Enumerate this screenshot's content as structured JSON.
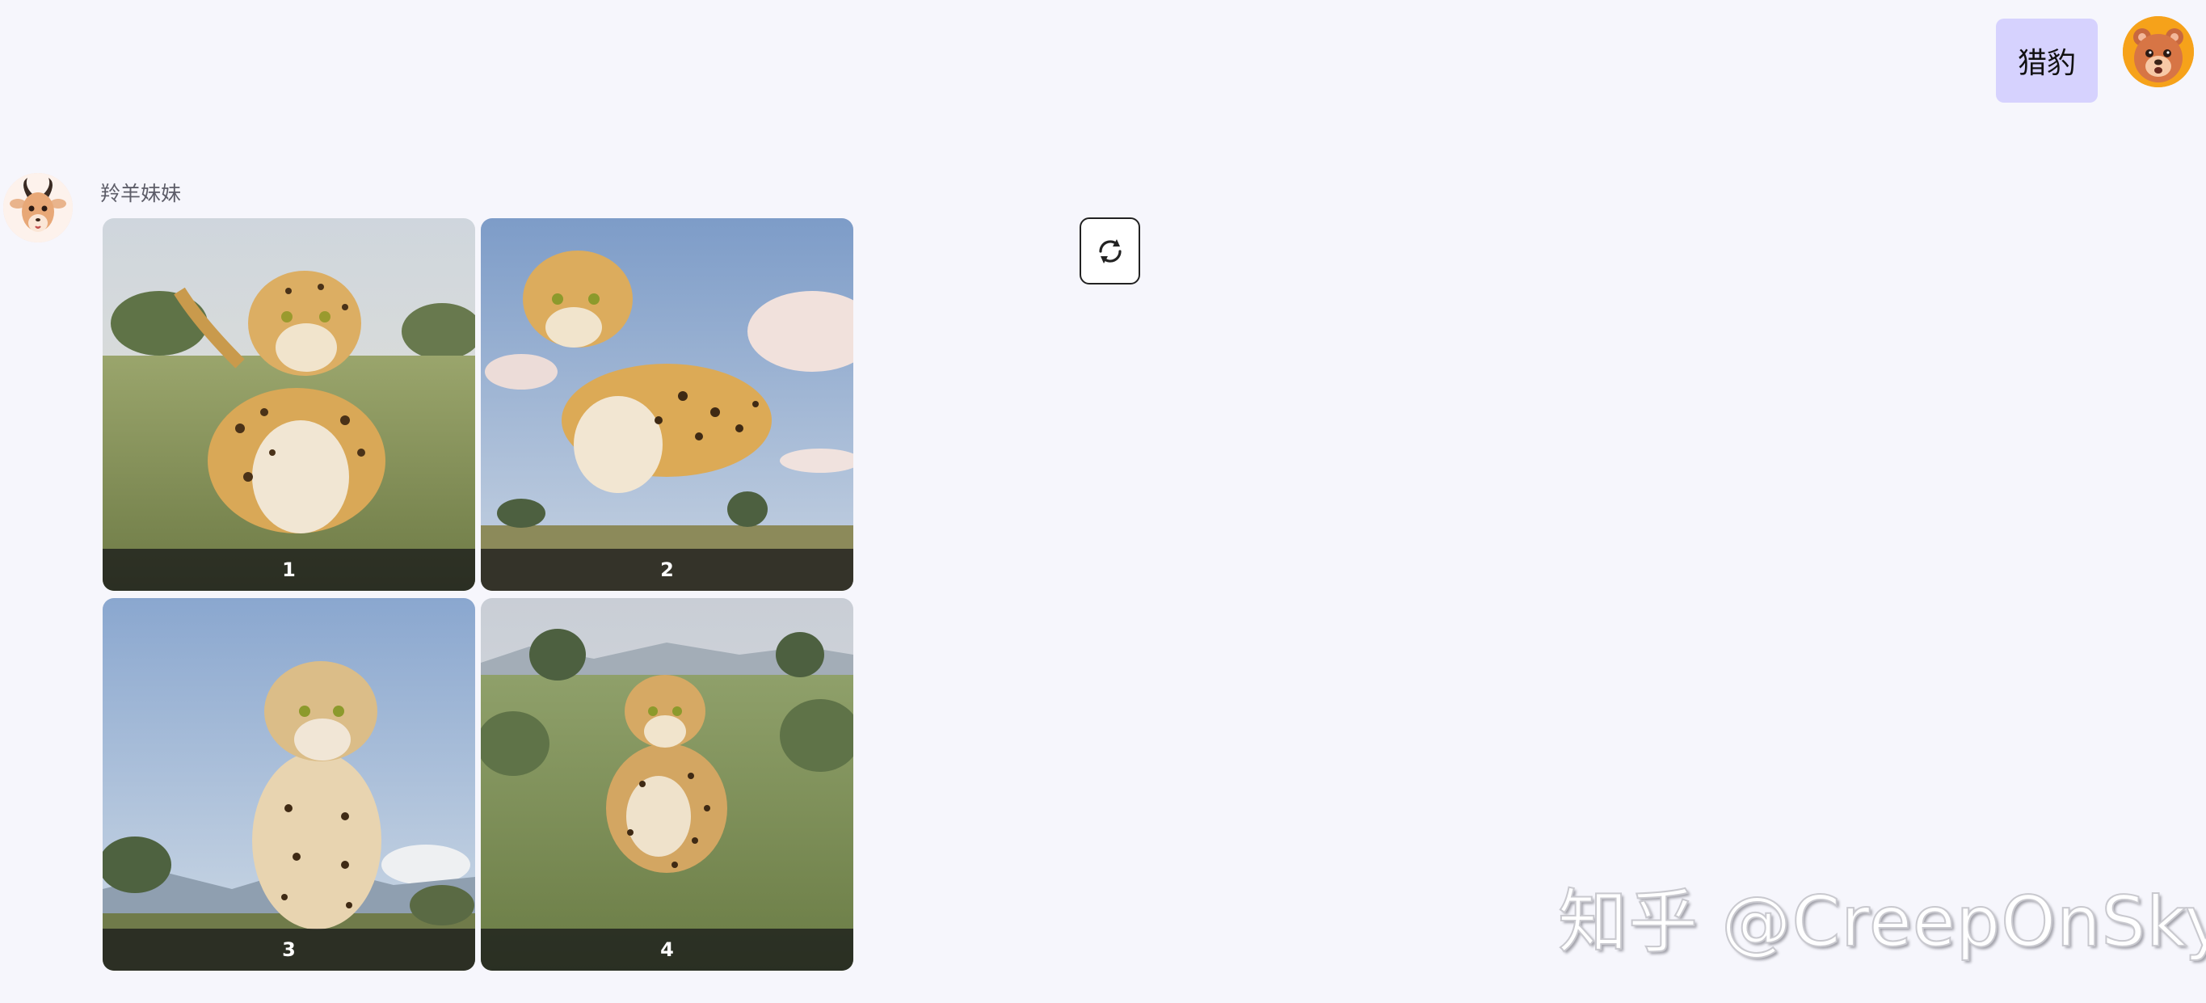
{
  "user_message": {
    "text": "猎豹"
  },
  "bot_message": {
    "sender_name": "羚羊妹妹",
    "images": [
      {
        "label": "1"
      },
      {
        "label": "2"
      },
      {
        "label": "3"
      },
      {
        "label": "4"
      }
    ]
  },
  "actions": {
    "regenerate_icon": "refresh-icon"
  },
  "watermark": "知乎 @CreepOnSky",
  "colors": {
    "user_bubble": "#d6d2fe",
    "background": "#f6f6fc"
  }
}
